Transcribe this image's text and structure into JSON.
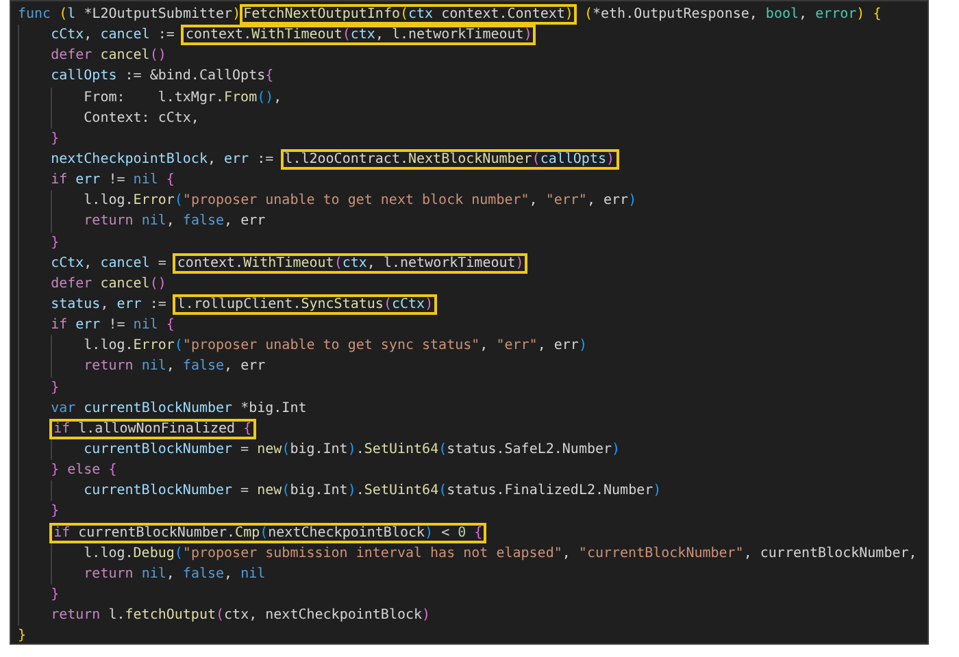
{
  "editor": {
    "lines": [
      {
        "segments": [
          {
            "boxed": false,
            "tokens": [
              {
                "text": "func ",
                "kind": "kwb"
              },
              {
                "text": "(",
                "kind": "b1"
              },
              {
                "text": "l",
                "kind": "v"
              },
              {
                "text": " *L2OutputSubmitter",
                "kind": "p"
              },
              {
                "text": ")",
                "kind": "b1"
              }
            ]
          },
          {
            "boxed": true,
            "tokens": [
              {
                "text": "FetchNextOutputInfo",
                "kind": "fn"
              },
              {
                "text": "(",
                "kind": "b1"
              },
              {
                "text": "ctx",
                "kind": "v"
              },
              {
                "text": " context.Context",
                "kind": "p"
              },
              {
                "text": ")",
                "kind": "b1"
              }
            ]
          },
          {
            "boxed": false,
            "tokens": [
              {
                "text": " (",
                "kind": "b1"
              },
              {
                "text": "*eth.OutputResponse, ",
                "kind": "p"
              },
              {
                "text": "bool",
                "kind": "type"
              },
              {
                "text": ", ",
                "kind": "p"
              },
              {
                "text": "error",
                "kind": "type"
              },
              {
                "text": ") {",
                "kind": "b1"
              }
            ]
          }
        ],
        "children": [
          {
            "segments": [
              {
                "boxed": false,
                "tokens": [
                  {
                    "text": "cCtx",
                    "kind": "v"
                  },
                  {
                    "text": ", ",
                    "kind": "p"
                  },
                  {
                    "text": "cancel",
                    "kind": "v"
                  },
                  {
                    "text": " := ",
                    "kind": "p"
                  }
                ]
              },
              {
                "boxed": true,
                "tokens": [
                  {
                    "text": "context.",
                    "kind": "p"
                  },
                  {
                    "text": "WithTimeout",
                    "kind": "fn"
                  },
                  {
                    "text": "(",
                    "kind": "b2"
                  },
                  {
                    "text": "ctx",
                    "kind": "v"
                  },
                  {
                    "text": ", l.networkTimeout",
                    "kind": "p"
                  },
                  {
                    "text": ")",
                    "kind": "b2"
                  }
                ]
              }
            ]
          },
          {
            "segments": [
              {
                "boxed": false,
                "tokens": [
                  {
                    "text": "defer ",
                    "kind": "kwp"
                  },
                  {
                    "text": "cancel",
                    "kind": "fn"
                  },
                  {
                    "text": "()",
                    "kind": "b2"
                  }
                ]
              }
            ]
          },
          {
            "segments": [
              {
                "boxed": false,
                "tokens": [
                  {
                    "text": "callOpts",
                    "kind": "v"
                  },
                  {
                    "text": " := &bind.CallOpts",
                    "kind": "p"
                  },
                  {
                    "text": "{",
                    "kind": "b2"
                  }
                ]
              }
            ],
            "children": [
              {
                "segments": [
                  {
                    "boxed": false,
                    "tokens": [
                      {
                        "text": "From:    l.txMgr.",
                        "kind": "p"
                      },
                      {
                        "text": "From",
                        "kind": "fn"
                      },
                      {
                        "text": "()",
                        "kind": "b3"
                      },
                      {
                        "text": ",",
                        "kind": "p"
                      }
                    ]
                  }
                ]
              },
              {
                "segments": [
                  {
                    "boxed": false,
                    "tokens": [
                      {
                        "text": "Context: cCtx,",
                        "kind": "p"
                      }
                    ]
                  }
                ]
              }
            ]
          },
          {
            "segments": [
              {
                "boxed": false,
                "tokens": [
                  {
                    "text": "}",
                    "kind": "b2"
                  }
                ]
              }
            ]
          },
          {
            "segments": [
              {
                "boxed": false,
                "tokens": [
                  {
                    "text": "nextCheckpointBlock",
                    "kind": "v"
                  },
                  {
                    "text": ", ",
                    "kind": "p"
                  },
                  {
                    "text": "err",
                    "kind": "v"
                  },
                  {
                    "text": " := ",
                    "kind": "p"
                  }
                ]
              },
              {
                "boxed": true,
                "tokens": [
                  {
                    "text": "l.l2ooContract.",
                    "kind": "p"
                  },
                  {
                    "text": "NextBlockNumber",
                    "kind": "fn"
                  },
                  {
                    "text": "(",
                    "kind": "b2"
                  },
                  {
                    "text": "callOpts",
                    "kind": "v"
                  },
                  {
                    "text": ")",
                    "kind": "b2"
                  }
                ]
              }
            ]
          },
          {
            "segments": [
              {
                "boxed": false,
                "tokens": [
                  {
                    "text": "if ",
                    "kind": "kwp"
                  },
                  {
                    "text": "err",
                    "kind": "v"
                  },
                  {
                    "text": " != ",
                    "kind": "p"
                  },
                  {
                    "text": "nil ",
                    "kind": "kwb"
                  },
                  {
                    "text": "{",
                    "kind": "b2"
                  }
                ]
              }
            ],
            "children": [
              {
                "segments": [
                  {
                    "boxed": false,
                    "tokens": [
                      {
                        "text": "l.log.",
                        "kind": "p"
                      },
                      {
                        "text": "Error",
                        "kind": "fn"
                      },
                      {
                        "text": "(",
                        "kind": "b3"
                      },
                      {
                        "text": "\"proposer unable to get next block number\"",
                        "kind": "s"
                      },
                      {
                        "text": ", ",
                        "kind": "p"
                      },
                      {
                        "text": "\"err\"",
                        "kind": "s"
                      },
                      {
                        "text": ", err",
                        "kind": "p"
                      },
                      {
                        "text": ")",
                        "kind": "b3"
                      }
                    ]
                  }
                ]
              },
              {
                "segments": [
                  {
                    "boxed": false,
                    "tokens": [
                      {
                        "text": "return ",
                        "kind": "kwp"
                      },
                      {
                        "text": "nil",
                        "kind": "kwb"
                      },
                      {
                        "text": ", ",
                        "kind": "p"
                      },
                      {
                        "text": "false",
                        "kind": "kwb"
                      },
                      {
                        "text": ", err",
                        "kind": "p"
                      }
                    ]
                  }
                ]
              }
            ]
          },
          {
            "segments": [
              {
                "boxed": false,
                "tokens": [
                  {
                    "text": "}",
                    "kind": "b2"
                  }
                ]
              }
            ]
          },
          {
            "segments": [
              {
                "boxed": false,
                "tokens": [
                  {
                    "text": "cCtx",
                    "kind": "v"
                  },
                  {
                    "text": ", ",
                    "kind": "p"
                  },
                  {
                    "text": "cancel",
                    "kind": "v"
                  },
                  {
                    "text": " = ",
                    "kind": "p"
                  }
                ]
              },
              {
                "boxed": true,
                "tokens": [
                  {
                    "text": "context.",
                    "kind": "p"
                  },
                  {
                    "text": "WithTimeout",
                    "kind": "fn"
                  },
                  {
                    "text": "(",
                    "kind": "b2"
                  },
                  {
                    "text": "ctx",
                    "kind": "v"
                  },
                  {
                    "text": ", l.networkTimeout",
                    "kind": "p"
                  },
                  {
                    "text": ")",
                    "kind": "b2"
                  }
                ]
              }
            ]
          },
          {
            "segments": [
              {
                "boxed": false,
                "tokens": [
                  {
                    "text": "defer ",
                    "kind": "kwp"
                  },
                  {
                    "text": "cancel",
                    "kind": "fn"
                  },
                  {
                    "text": "()",
                    "kind": "b2"
                  }
                ]
              }
            ]
          },
          {
            "segments": [
              {
                "boxed": false,
                "tokens": [
                  {
                    "text": "status",
                    "kind": "v"
                  },
                  {
                    "text": ", ",
                    "kind": "p"
                  },
                  {
                    "text": "err",
                    "kind": "v"
                  },
                  {
                    "text": " := ",
                    "kind": "p"
                  }
                ]
              },
              {
                "boxed": true,
                "tokens": [
                  {
                    "text": "l.rollupClient.",
                    "kind": "p"
                  },
                  {
                    "text": "SyncStatus",
                    "kind": "fn"
                  },
                  {
                    "text": "(",
                    "kind": "b2"
                  },
                  {
                    "text": "cCtx",
                    "kind": "v"
                  },
                  {
                    "text": ")",
                    "kind": "b2"
                  }
                ]
              }
            ]
          },
          {
            "segments": [
              {
                "boxed": false,
                "tokens": [
                  {
                    "text": "if ",
                    "kind": "kwp"
                  },
                  {
                    "text": "err",
                    "kind": "v"
                  },
                  {
                    "text": " != ",
                    "kind": "p"
                  },
                  {
                    "text": "nil ",
                    "kind": "kwb"
                  },
                  {
                    "text": "{",
                    "kind": "b2"
                  }
                ]
              }
            ],
            "children": [
              {
                "segments": [
                  {
                    "boxed": false,
                    "tokens": [
                      {
                        "text": "l.log.",
                        "kind": "p"
                      },
                      {
                        "text": "Error",
                        "kind": "fn"
                      },
                      {
                        "text": "(",
                        "kind": "b3"
                      },
                      {
                        "text": "\"proposer unable to get sync status\"",
                        "kind": "s"
                      },
                      {
                        "text": ", ",
                        "kind": "p"
                      },
                      {
                        "text": "\"err\"",
                        "kind": "s"
                      },
                      {
                        "text": ", err",
                        "kind": "p"
                      },
                      {
                        "text": ")",
                        "kind": "b3"
                      }
                    ]
                  }
                ]
              },
              {
                "segments": [
                  {
                    "boxed": false,
                    "tokens": [
                      {
                        "text": "return ",
                        "kind": "kwp"
                      },
                      {
                        "text": "nil",
                        "kind": "kwb"
                      },
                      {
                        "text": ", ",
                        "kind": "p"
                      },
                      {
                        "text": "false",
                        "kind": "kwb"
                      },
                      {
                        "text": ", err",
                        "kind": "p"
                      }
                    ]
                  }
                ]
              }
            ]
          },
          {
            "segments": [
              {
                "boxed": false,
                "tokens": [
                  {
                    "text": "}",
                    "kind": "b2"
                  }
                ]
              }
            ]
          },
          {
            "segments": [
              {
                "boxed": false,
                "tokens": [
                  {
                    "text": "var ",
                    "kind": "kwb"
                  },
                  {
                    "text": "currentBlockNumber",
                    "kind": "v"
                  },
                  {
                    "text": " *big.Int",
                    "kind": "p"
                  }
                ]
              }
            ]
          },
          {
            "segments": [
              {
                "boxed": true,
                "tokens": [
                  {
                    "text": "if",
                    "kind": "kwp"
                  },
                  {
                    "text": " l.allowNonFinalized ",
                    "kind": "p"
                  },
                  {
                    "text": "{",
                    "kind": "b2"
                  }
                ]
              }
            ],
            "children": [
              {
                "segments": [
                  {
                    "boxed": false,
                    "tokens": [
                      {
                        "text": "currentBlockNumber",
                        "kind": "v"
                      },
                      {
                        "text": " = ",
                        "kind": "p"
                      },
                      {
                        "text": "new",
                        "kind": "fn"
                      },
                      {
                        "text": "(",
                        "kind": "b3"
                      },
                      {
                        "text": "big.Int",
                        "kind": "p"
                      },
                      {
                        "text": ")",
                        "kind": "b3"
                      },
                      {
                        "text": ".",
                        "kind": "p"
                      },
                      {
                        "text": "SetUint64",
                        "kind": "fn"
                      },
                      {
                        "text": "(",
                        "kind": "b3"
                      },
                      {
                        "text": "status.SafeL2.Number",
                        "kind": "p"
                      },
                      {
                        "text": ")",
                        "kind": "b3"
                      }
                    ]
                  }
                ]
              }
            ]
          },
          {
            "segments": [
              {
                "boxed": false,
                "tokens": [
                  {
                    "text": "} ",
                    "kind": "b2"
                  },
                  {
                    "text": "else ",
                    "kind": "kwp"
                  },
                  {
                    "text": "{",
                    "kind": "b2"
                  }
                ]
              }
            ],
            "children": [
              {
                "segments": [
                  {
                    "boxed": false,
                    "tokens": [
                      {
                        "text": "currentBlockNumber",
                        "kind": "v"
                      },
                      {
                        "text": " = ",
                        "kind": "p"
                      },
                      {
                        "text": "new",
                        "kind": "fn"
                      },
                      {
                        "text": "(",
                        "kind": "b3"
                      },
                      {
                        "text": "big.Int",
                        "kind": "p"
                      },
                      {
                        "text": ")",
                        "kind": "b3"
                      },
                      {
                        "text": ".",
                        "kind": "p"
                      },
                      {
                        "text": "SetUint64",
                        "kind": "fn"
                      },
                      {
                        "text": "(",
                        "kind": "b3"
                      },
                      {
                        "text": "status.FinalizedL2.Number",
                        "kind": "p"
                      },
                      {
                        "text": ")",
                        "kind": "b3"
                      }
                    ]
                  }
                ]
              }
            ]
          },
          {
            "segments": [
              {
                "boxed": false,
                "tokens": [
                  {
                    "text": "}",
                    "kind": "b2"
                  }
                ]
              }
            ]
          },
          {
            "segments": [
              {
                "boxed": true,
                "tokens": [
                  {
                    "text": "if",
                    "kind": "kwp"
                  },
                  {
                    "text": " currentBlockNumber.",
                    "kind": "p"
                  },
                  {
                    "text": "Cmp",
                    "kind": "fn"
                  },
                  {
                    "text": "(",
                    "kind": "b3"
                  },
                  {
                    "text": "nextCheckpointBlock",
                    "kind": "p"
                  },
                  {
                    "text": ")",
                    "kind": "b3"
                  },
                  {
                    "text": " < ",
                    "kind": "p"
                  },
                  {
                    "text": "0 ",
                    "kind": "n"
                  },
                  {
                    "text": "{",
                    "kind": "b2"
                  }
                ]
              }
            ],
            "children": [
              {
                "segments": [
                  {
                    "boxed": false,
                    "tokens": [
                      {
                        "text": "l.log.",
                        "kind": "p"
                      },
                      {
                        "text": "Debug",
                        "kind": "fn"
                      },
                      {
                        "text": "(",
                        "kind": "b3"
                      },
                      {
                        "text": "\"proposer submission interval has not elapsed\"",
                        "kind": "s"
                      },
                      {
                        "text": ", ",
                        "kind": "p"
                      },
                      {
                        "text": "\"currentBlockNumber\"",
                        "kind": "s"
                      },
                      {
                        "text": ", currentBlockNumber,",
                        "kind": "p"
                      }
                    ]
                  }
                ]
              },
              {
                "segments": [
                  {
                    "boxed": false,
                    "tokens": [
                      {
                        "text": "return ",
                        "kind": "kwp"
                      },
                      {
                        "text": "nil",
                        "kind": "kwb"
                      },
                      {
                        "text": ", ",
                        "kind": "p"
                      },
                      {
                        "text": "false",
                        "kind": "kwb"
                      },
                      {
                        "text": ", ",
                        "kind": "p"
                      },
                      {
                        "text": "nil",
                        "kind": "kwb"
                      }
                    ]
                  }
                ]
              }
            ]
          },
          {
            "segments": [
              {
                "boxed": false,
                "tokens": [
                  {
                    "text": "}",
                    "kind": "b2"
                  }
                ]
              }
            ]
          },
          {
            "segments": [
              {
                "boxed": false,
                "tokens": [
                  {
                    "text": "return",
                    "kind": "kwp"
                  },
                  {
                    "text": " l.",
                    "kind": "p"
                  },
                  {
                    "text": "fetchOutput",
                    "kind": "fn"
                  },
                  {
                    "text": "(",
                    "kind": "b2"
                  },
                  {
                    "text": "ctx, nextCheckpointBlock",
                    "kind": "p"
                  },
                  {
                    "text": ")",
                    "kind": "b2"
                  }
                ]
              }
            ]
          }
        ]
      },
      {
        "segments": [
          {
            "boxed": false,
            "tokens": [
              {
                "text": "}",
                "kind": "b1"
              }
            ]
          }
        ]
      }
    ]
  }
}
